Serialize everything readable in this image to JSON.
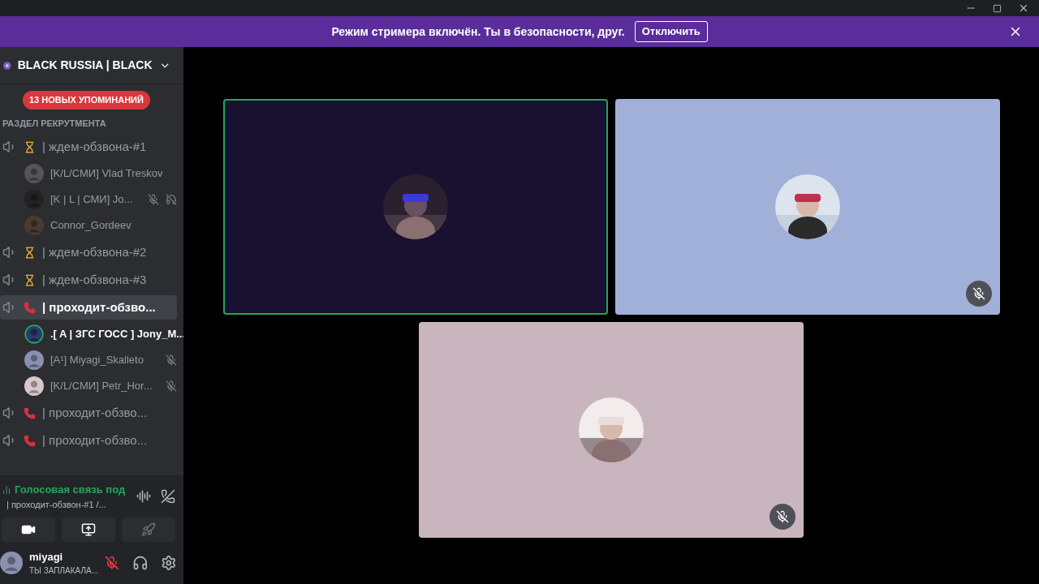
{
  "banner": {
    "text": "Режим стримера включён. Ты в безопасности, друг.",
    "button": "Отключить"
  },
  "server": {
    "name": "BLACK RUSSIA | BLACK"
  },
  "mentions": "13 НОВЫХ УПОМИНАНИЙ",
  "category": "РАЗДЕЛ РЕКРУТМЕНТА",
  "channels": [
    {
      "kind": "hourglass",
      "name": "| ждем-обзвона-#1",
      "selected": false,
      "children": [
        {
          "name": "[K/L/СМИ] Vlad Treskov",
          "speaking": false,
          "muted": false,
          "deafened": false
        },
        {
          "name": "[K | L | СМИ] Jo...",
          "speaking": false,
          "muted": true,
          "deafened": true
        },
        {
          "name": "Connor_Gordeev",
          "speaking": false,
          "muted": false,
          "deafened": false
        }
      ]
    },
    {
      "kind": "hourglass",
      "name": "| ждем-обзвона-#2",
      "selected": false
    },
    {
      "kind": "hourglass",
      "name": "| ждем-обзвона-#3",
      "selected": false
    },
    {
      "kind": "phone",
      "name": "| проходит-обзво...",
      "selected": true,
      "children": [
        {
          "name": ".[ A | ЗГС ГОСС ] Jony_M...",
          "speaking": true,
          "muted": false,
          "deafened": false
        },
        {
          "name": "[A¹] Miyagi_Skalleto",
          "speaking": false,
          "muted": true,
          "deafened": false
        },
        {
          "name": "[K/L/СМИ] Petr_Hor...",
          "speaking": false,
          "muted": true,
          "deafened": false
        }
      ]
    },
    {
      "kind": "phone",
      "name": "| проходит-обзво...",
      "selected": false
    },
    {
      "kind": "phone",
      "name": "| проходит-обзво...",
      "selected": false
    }
  ],
  "voice": {
    "status": "Голосовая связь под",
    "channel": "| проходит-обзвон-#1 /..."
  },
  "user": {
    "name": "miyagi",
    "status": "ТЫ ЗАПЛАКАЛА...",
    "muted": true
  },
  "tiles": [
    {
      "color": "#1a1030",
      "speaking": true,
      "muted": false
    },
    {
      "color": "#a1b0d8",
      "speaking": false,
      "muted": true
    },
    {
      "color": "#c8b5bd",
      "speaking": false,
      "muted": true
    }
  ]
}
